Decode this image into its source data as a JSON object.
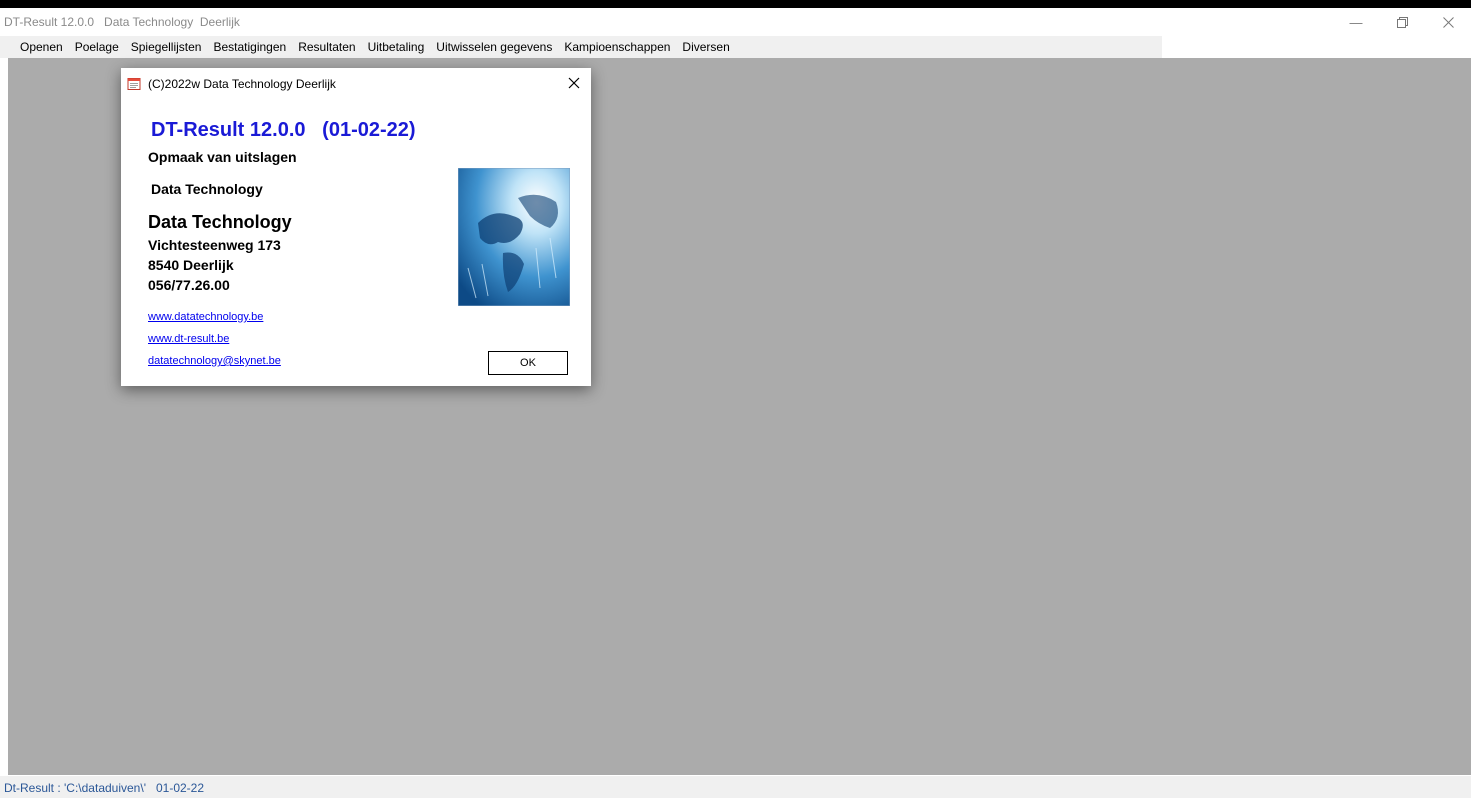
{
  "window": {
    "title": "DT-Result 12.0.0   Data Technology  Deerlijk"
  },
  "menu": {
    "items": [
      {
        "label": "Openen"
      },
      {
        "label": "Poelage"
      },
      {
        "label": "Spiegellijsten"
      },
      {
        "label": "Bestatigingen"
      },
      {
        "label": "Resultaten"
      },
      {
        "label": "Uitbetaling"
      },
      {
        "label": "Uitwisselen gegevens"
      },
      {
        "label": "Kampioenschappen"
      },
      {
        "label": "Diversen"
      }
    ]
  },
  "dialog": {
    "title": "(C)2022w Data Technology Deerlijk",
    "product_title": "DT-Result 12.0.0   (01-02-22)",
    "subtitle": "Opmaak van uitslagen",
    "company_short": "Data Technology",
    "company_name": "Data Technology",
    "address_street": "Vichtesteenweg 173",
    "address_city": "8540 Deerlijk",
    "phone": "056/77.26.00",
    "links": [
      "www.datatechnology.be",
      "www.dt-result.be",
      "datatechnology@skynet.be"
    ],
    "ok_label": "OK"
  },
  "status": {
    "text": "Dt-Result : 'C:\\dataduiven\\'   01-02-22"
  },
  "icons": {
    "dialog_icon": "notepad-icon",
    "close": "close-icon",
    "minimize": "minimize-icon",
    "restore": "restore-icon",
    "window_close": "close-icon"
  },
  "colors": {
    "client_background": "#ababab",
    "product_title": "#1a1ad6",
    "link": "#0000ee",
    "status_text": "#2b5797"
  }
}
